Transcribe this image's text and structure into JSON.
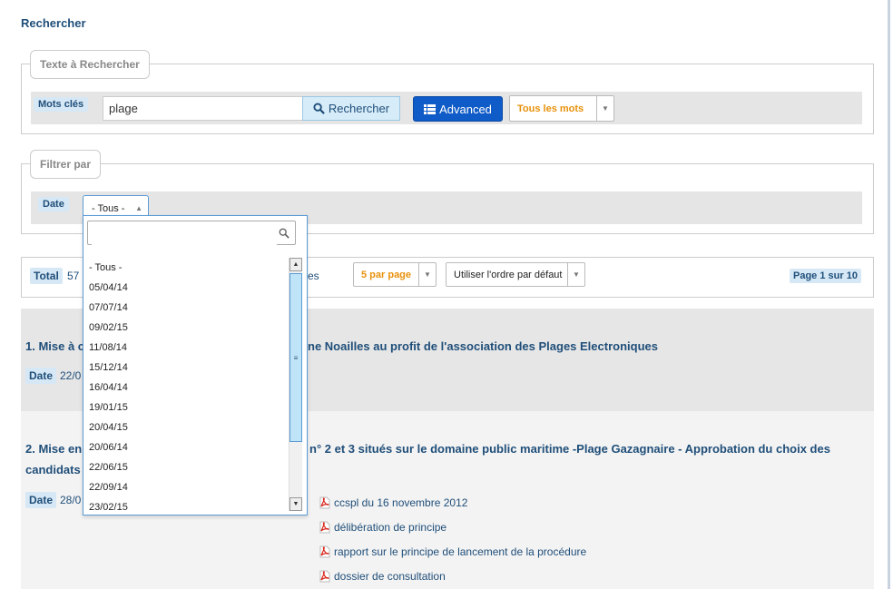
{
  "page": {
    "title": "Rechercher"
  },
  "search": {
    "legend": "Texte à Rechercher",
    "keywords_label": "Mots clés",
    "keywords_value": "plage",
    "search_button": "Rechercher",
    "advanced_button": "Advanced",
    "match_mode": "Tous les mots"
  },
  "filter": {
    "legend": "Filtrer par",
    "date_label": "Date",
    "date_selected": "- Tous -"
  },
  "dropdown": {
    "options": [
      "- Tous -",
      "05/04/14",
      "07/07/14",
      "09/02/15",
      "11/08/14",
      "15/12/14",
      "16/04/14",
      "19/01/15",
      "20/04/15",
      "20/06/14",
      "22/06/15",
      "22/09/14",
      "23/02/15"
    ]
  },
  "results_bar": {
    "total_label": "Total",
    "total_value": "57",
    "total_suffix_visible": "es",
    "per_page": "5 par page",
    "order": "Utiliser l'ordre par défaut",
    "page_info": "Page 1 sur 10"
  },
  "results": [
    {
      "title_start": "1. Mise à c",
      "title_rest": "ne Noailles au profit de l'association des Plages Electroniques",
      "date_label": "Date",
      "date_value": "22/0"
    },
    {
      "title_start": "2. Mise en",
      "title_rest": "n° 2 et 3 situés sur le domaine public maritime -Plage Gazagnaire - Approbation du choix des",
      "title_line2": "candidats",
      "date_label": "Date",
      "date_value": "28/0",
      "documents": [
        "ccspl du 16 novembre 2012",
        "délibération de principe",
        "rapport sur le principe de lancement de la procédure",
        "dossier de consultation"
      ]
    }
  ],
  "colors": {
    "primary": "#1f4e79",
    "accent_blue": "#0f5bc7",
    "orange": "#e8910c",
    "pill_bg": "#d6e8f5"
  }
}
